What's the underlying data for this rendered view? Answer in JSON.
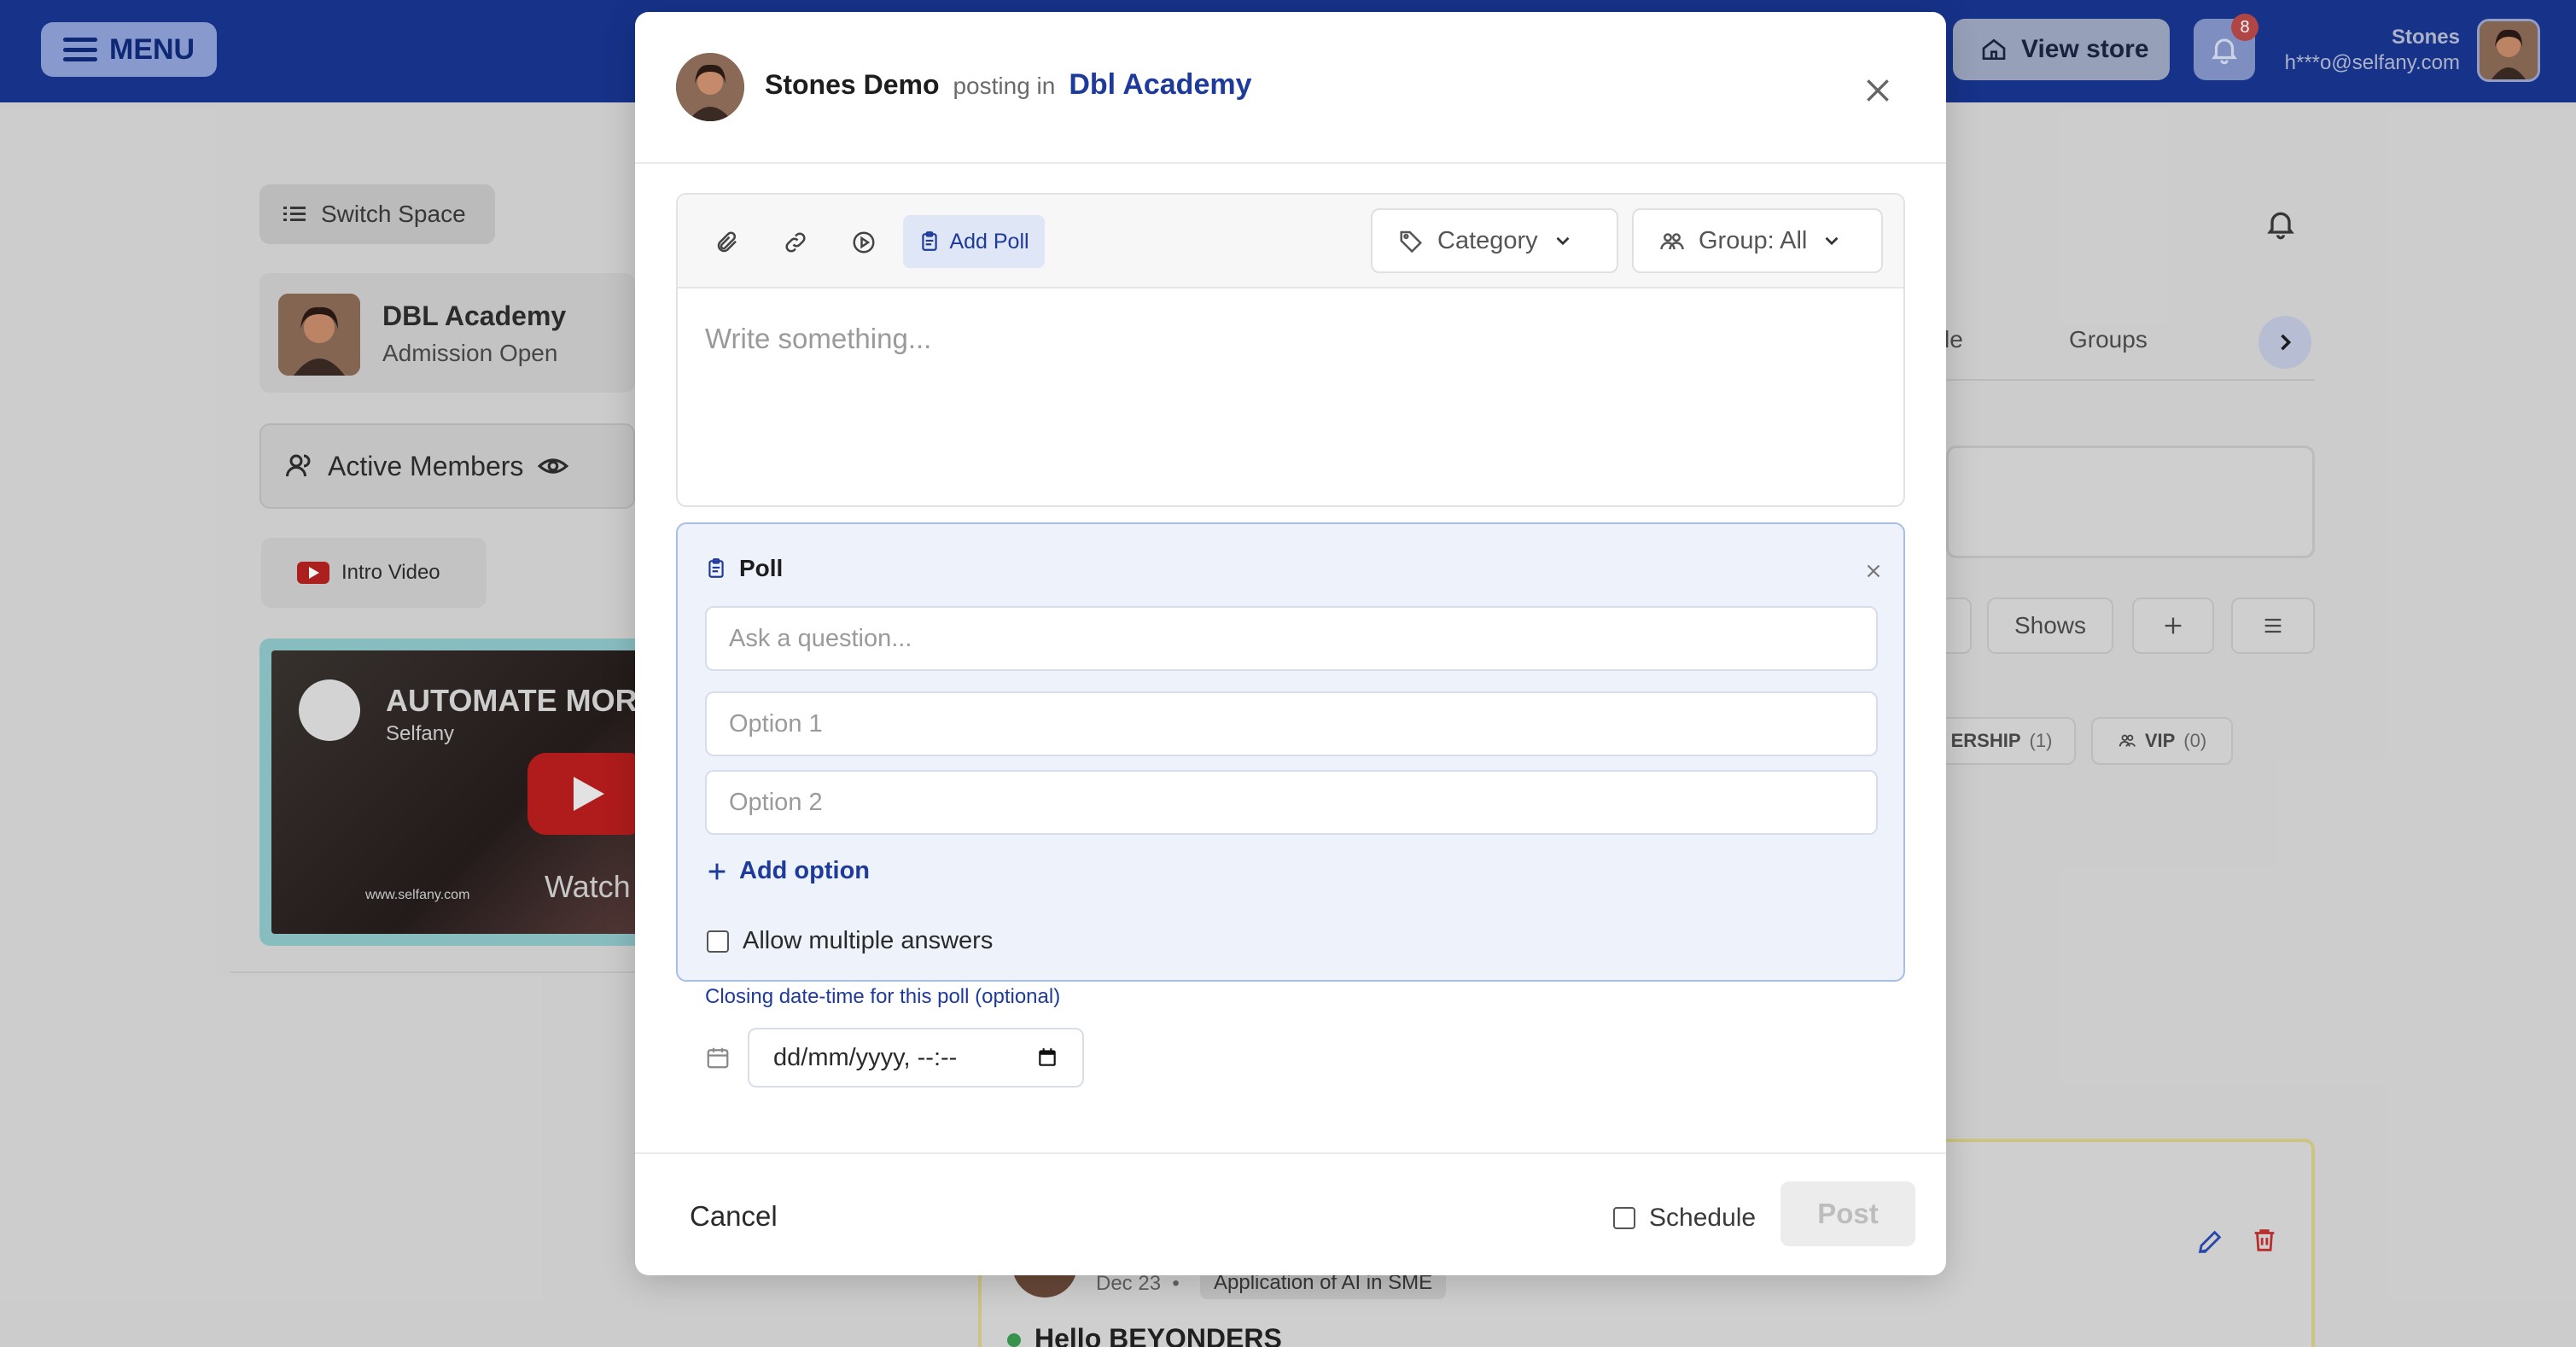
{
  "colors": {
    "brand": "#17358f",
    "accent": "#1e3a9a",
    "poll_bg": "#edf2fb",
    "badge": "#b84848"
  },
  "topbar": {
    "menu_label": "MENU",
    "view_store_label": "View store",
    "notification_count": "8",
    "user_name": "Stones",
    "user_email": "h***o@selfany.com"
  },
  "sidebar": {
    "switch_space_label": "Switch Space",
    "space_title": "DBL Academy",
    "space_subtitle": "Admission Open",
    "active_members_label": "Active Members",
    "intro_video_label": "Intro Video",
    "video": {
      "title": "AUTOMATE MORE",
      "channel": "Selfany",
      "watch_label": "Watch",
      "url": "www.selfany.com"
    }
  },
  "background": {
    "tabs": [
      "le",
      "Groups"
    ],
    "buttons": {
      "shows": "Shows"
    },
    "chips": [
      {
        "label": "ERSHIP",
        "count": "(1)"
      },
      {
        "label": "VIP",
        "count": "(0)"
      }
    ],
    "post": {
      "date": "Dec 23",
      "separator": "•",
      "tag": "Application of AI in SME",
      "title": "Hello BEYONDERS"
    }
  },
  "modal": {
    "author": "Stones Demo",
    "posting_in": "posting in",
    "space": "Dbl Academy",
    "toolbar": {
      "add_poll_label": "Add Poll",
      "category_label": "Category",
      "group_label": "Group: All"
    },
    "composer_placeholder": "Write something...",
    "poll": {
      "title": "Poll",
      "question_placeholder": "Ask a question...",
      "options": [
        "Option 1",
        "Option 2"
      ],
      "add_option_label": "Add option",
      "allow_multiple_label": "Allow multiple answers",
      "closing_label": "Closing date-time for this poll (optional)",
      "date_placeholder": "dd/mm/yyyy, --:--"
    },
    "footer": {
      "cancel_label": "Cancel",
      "schedule_label": "Schedule",
      "post_label": "Post"
    }
  }
}
